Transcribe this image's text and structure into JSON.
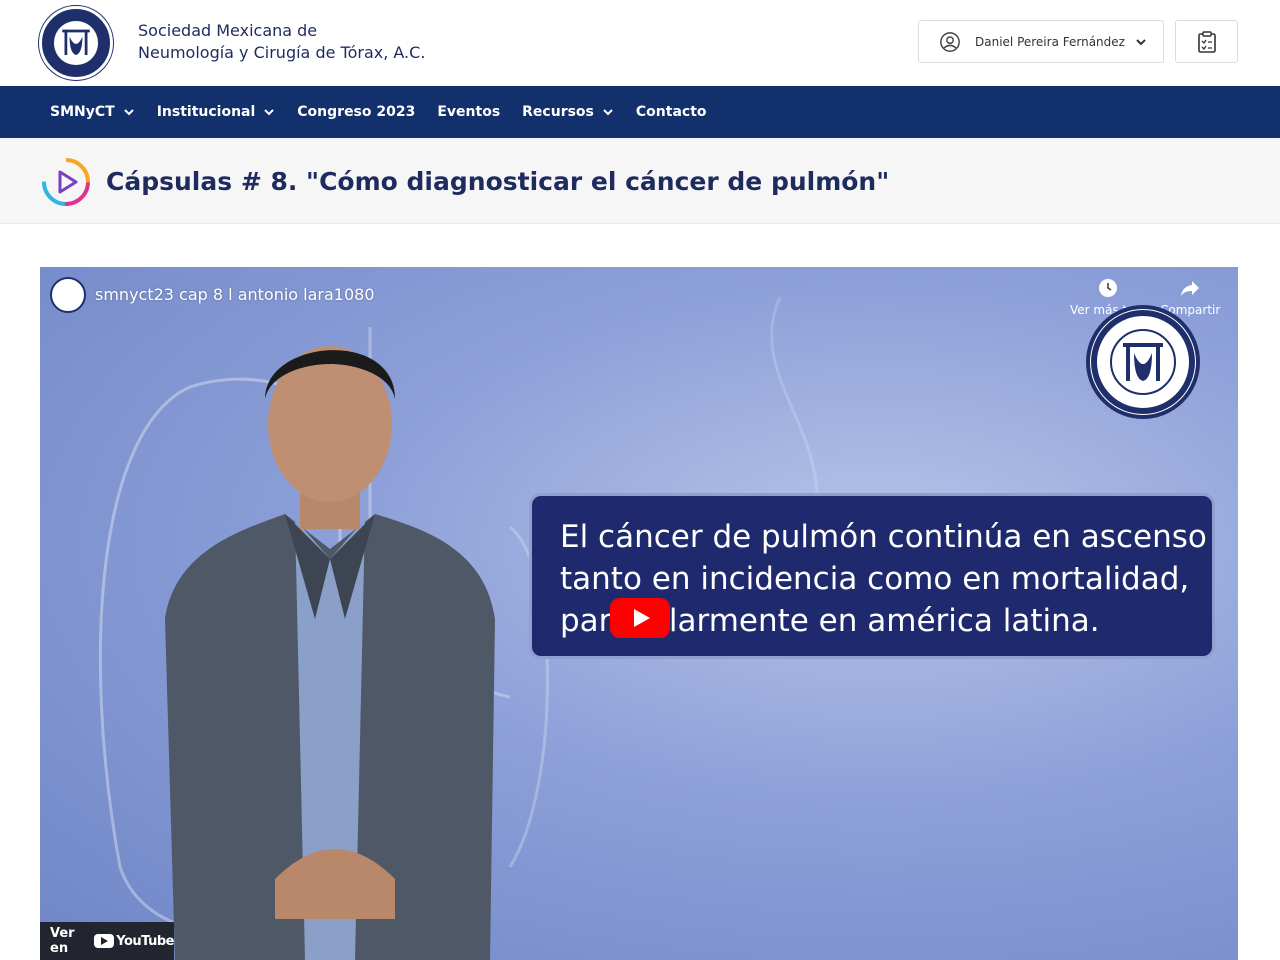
{
  "header": {
    "org_line1": "Sociedad Mexicana de",
    "org_line2": "Neumología y Cirugía de Tórax, A.C.",
    "user_name": "Daniel Pereira Fernández"
  },
  "nav": {
    "items": [
      {
        "label": "SMNyCT",
        "dropdown": true
      },
      {
        "label": "Institucional",
        "dropdown": true
      },
      {
        "label": "Congreso 2023",
        "dropdown": false
      },
      {
        "label": "Eventos",
        "dropdown": false
      },
      {
        "label": "Recursos",
        "dropdown": true
      },
      {
        "label": "Contacto",
        "dropdown": false
      }
    ]
  },
  "page": {
    "title": "Cápsulas # 8. \"Cómo diagnosticar el cáncer de pulmón\""
  },
  "video": {
    "title": "smnyct23 cap 8 l antonio lara1080",
    "watch_later_label": "Ver más ta...",
    "share_label": "Compartir",
    "caption_lines": [
      "El cáncer de pulmón continúa en ascenso",
      "tanto en incidencia como en mortalidad,",
      "particularmente en américa latina."
    ],
    "watch_on_label": "Ver en",
    "youtube_word": "YouTube"
  },
  "colors": {
    "nav_bg": "#12306b",
    "title_text": "#1e2b5f",
    "caption_bg": "#1f2a6e",
    "play_red": "#ff0000"
  }
}
